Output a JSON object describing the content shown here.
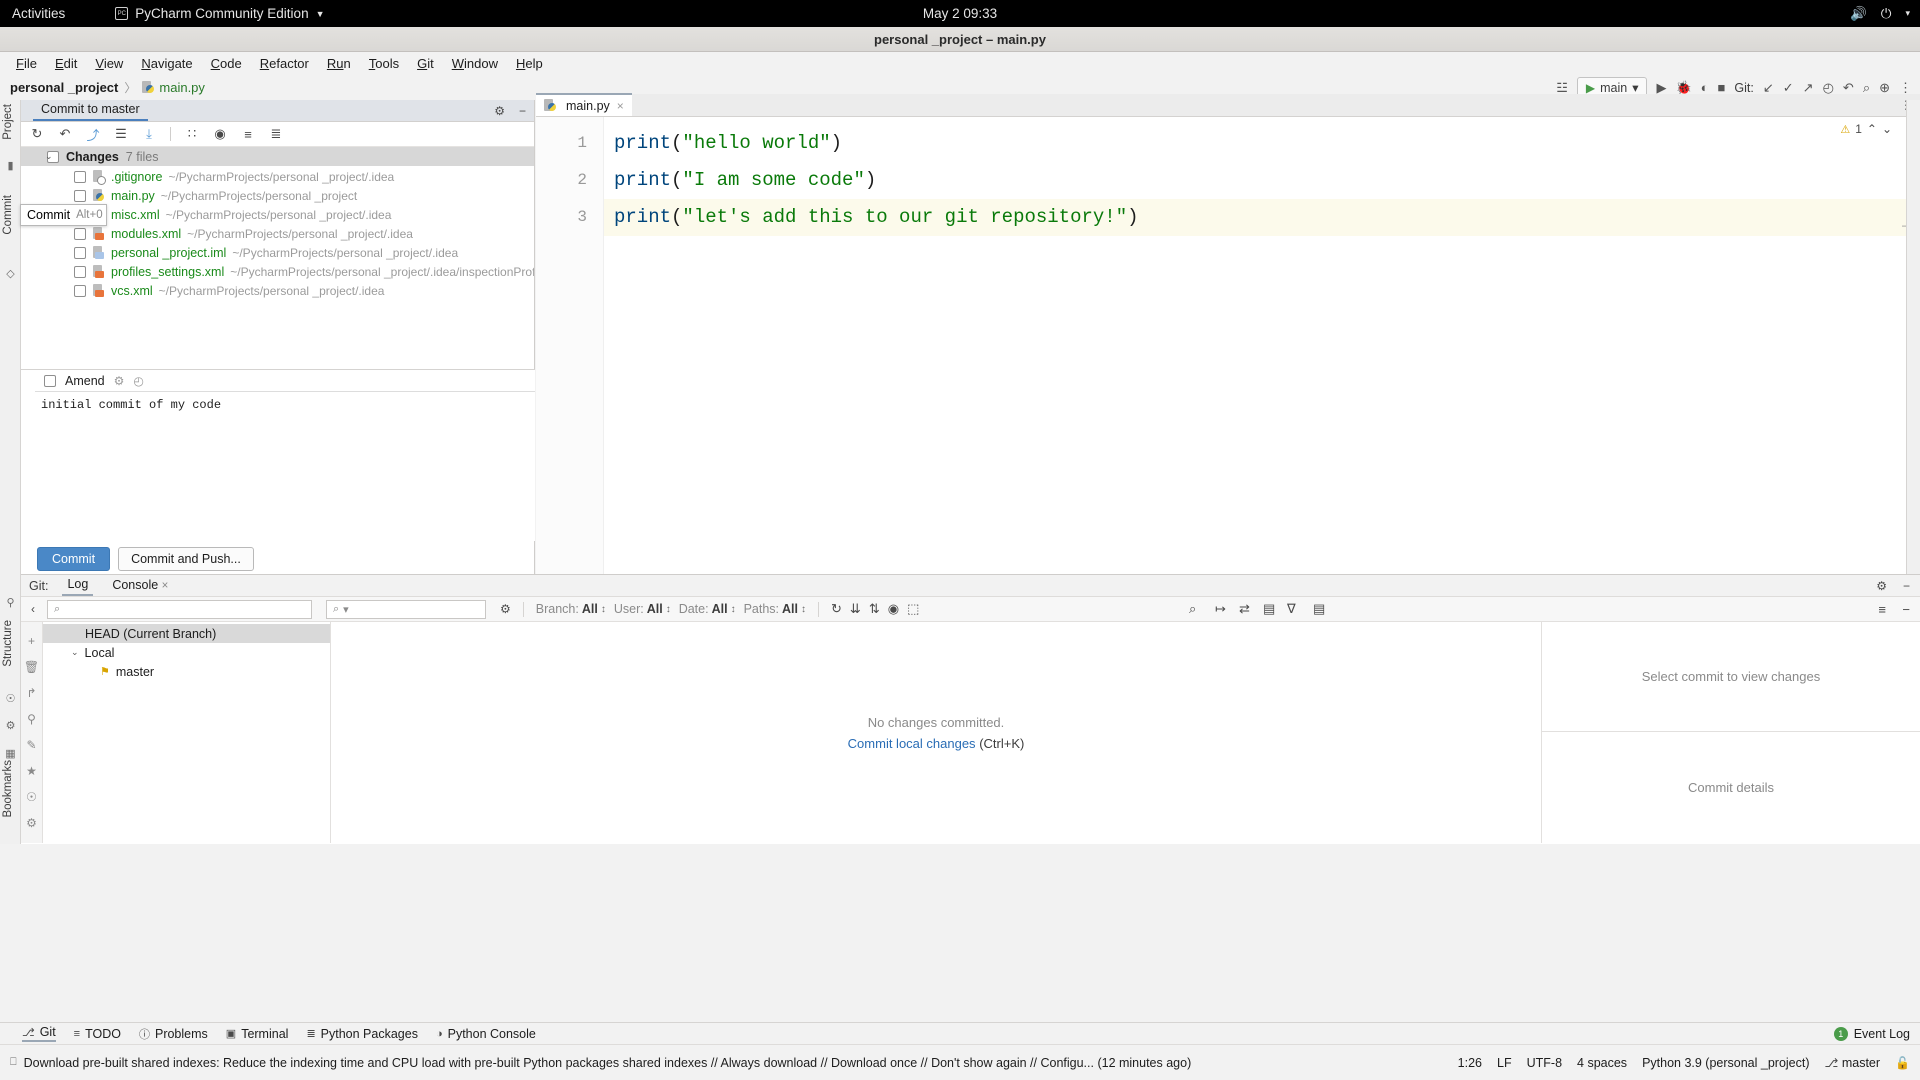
{
  "gnome": {
    "activities": "Activities",
    "app_name": "PyCharm Community Edition",
    "app_badge": "PC",
    "dropdown_caret": "▼",
    "clock": "May 2  09:33",
    "volume_icon": "🔊",
    "power_icon": "⏻",
    "caret_icon": "▾"
  },
  "window": {
    "title": "personal _project – main.py"
  },
  "menu": {
    "items": [
      {
        "mnemonic": "F",
        "rest": "ile"
      },
      {
        "mnemonic": "E",
        "rest": "dit"
      },
      {
        "mnemonic": "V",
        "rest": "iew"
      },
      {
        "mnemonic": "N",
        "rest": "avigate"
      },
      {
        "mnemonic": "C",
        "rest": "ode"
      },
      {
        "mnemonic": "R",
        "rest": "efactor"
      },
      {
        "mnemonic": "Ru",
        "rest": "n"
      },
      {
        "mnemonic": "T",
        "rest": "ools"
      },
      {
        "mnemonic": "G",
        "rest": "it"
      },
      {
        "mnemonic": "W",
        "rest": "indow"
      },
      {
        "mnemonic": "H",
        "rest": "elp"
      }
    ]
  },
  "navbar": {
    "project": "personal _project",
    "separator": "〉",
    "file": "main.py",
    "run_config": "main",
    "run_caret": "▾",
    "git_label": "Git:",
    "icons": {
      "run": "▶",
      "debug": "🐞",
      "coverage": "◐",
      "stop": "■",
      "update": "↙",
      "commit": "✓",
      "push": "↗",
      "history": "◴",
      "rollback": "↶",
      "search": "⌕",
      "plugin": "⊕",
      "more": "⋮",
      "layout": "☳"
    }
  },
  "left_strip": {
    "project_tab": "Project",
    "commit_tab": "Commit",
    "structure_tab": "Structure",
    "bookmarks_tab": "Bookmarks"
  },
  "commit_window": {
    "tab_label": "Commit to master",
    "header_icons": {
      "gear": "⚙",
      "minimize": "−"
    },
    "toolbar_icons": [
      {
        "name": "refresh-icon",
        "glyph": "↻"
      },
      {
        "name": "rollback-icon",
        "glyph": "↶"
      },
      {
        "name": "shelve-icon",
        "glyph": "⤴"
      },
      {
        "name": "diff-icon",
        "glyph": "☰"
      },
      {
        "name": "download-icon",
        "glyph": "⤓"
      },
      {
        "name": "group-by-icon",
        "glyph": "∷"
      },
      {
        "name": "preview-icon",
        "glyph": "◉"
      },
      {
        "name": "expand-all-icon",
        "glyph": "≡"
      },
      {
        "name": "collapse-all-icon",
        "glyph": "≣"
      }
    ],
    "changes_group": {
      "chevron": "⌄",
      "label": "Changes",
      "count": "7 files"
    },
    "files": [
      {
        "name": ".gitignore",
        "path": "~/PycharmProjects/personal _project/.idea",
        "icon": "gitignore-icon",
        "kind": "ign"
      },
      {
        "name": "main.py",
        "path": "~/PycharmProjects/personal _project",
        "icon": "python-file-icon",
        "kind": "py"
      },
      {
        "name": "misc.xml",
        "path": "~/PycharmProjects/personal _project/.idea",
        "icon": "xml-file-icon",
        "kind": "xml"
      },
      {
        "name": "modules.xml",
        "path": "~/PycharmProjects/personal _project/.idea",
        "icon": "xml-file-icon",
        "kind": "xml"
      },
      {
        "name": "personal _project.iml",
        "path": "~/PycharmProjects/personal _project/.idea",
        "icon": "iml-file-icon",
        "kind": "iml"
      },
      {
        "name": "profiles_settings.xml",
        "path": "~/PycharmProjects/personal _project/.idea/inspectionProfiles",
        "icon": "xml-file-icon",
        "kind": "xml"
      },
      {
        "name": "vcs.xml",
        "path": "~/PycharmProjects/personal _project/.idea",
        "icon": "xml-file-icon",
        "kind": "xml"
      }
    ],
    "tooltip": {
      "label": "Commit",
      "shortcut": "Alt+0"
    },
    "amend": {
      "label": "Amend",
      "gear_icon": "⚙",
      "history_icon": "◴"
    },
    "message": "initial commit of my code",
    "buttons": {
      "commit": "Commit",
      "commit_and_push": "Commit and Push..."
    }
  },
  "editor": {
    "tab": {
      "label": "main.py",
      "close": "×"
    },
    "gear_icon": "⋮",
    "warning": {
      "count": "1",
      "icon": "⚠",
      "chevron_up": "⌃",
      "chevron_down": "⌄"
    },
    "fold_mark": "—",
    "lines": [
      {
        "num": "1",
        "fn": "print",
        "open": "(",
        "string": "\"hello world\"",
        "close": ")"
      },
      {
        "num": "2",
        "fn": "print",
        "open": "(",
        "string": "\"I am some code\"",
        "close": ")"
      },
      {
        "num": "3",
        "fn": "print",
        "open": "(",
        "string": "\"let's add this to our git repository!\"",
        "close": ")"
      }
    ]
  },
  "git_window": {
    "label": "Git:",
    "tabs": [
      {
        "label": "Log",
        "active": true,
        "closable": false
      },
      {
        "label": "Console",
        "active": false,
        "closable": true,
        "close": "×"
      }
    ],
    "header_icons": {
      "gear": "⚙",
      "minimize": "−"
    },
    "toolbar": {
      "collapse_icon": "‹",
      "search_placeholder": "",
      "search_icon": "⌕",
      "branch_search_icon": "⌕",
      "branch_search_caret": "▾",
      "settings_icon": "⚙",
      "filters": [
        {
          "label": "Branch:",
          "value": "All"
        },
        {
          "label": "User:",
          "value": "All"
        },
        {
          "label": "Date:",
          "value": "All"
        },
        {
          "label": "Paths:",
          "value": "All"
        }
      ],
      "filter_caret": "↕",
      "right_icons": [
        {
          "name": "refresh-icon",
          "glyph": "↻"
        },
        {
          "name": "fetch-icon",
          "glyph": "⇊"
        },
        {
          "name": "sort-icon",
          "glyph": "⇅"
        },
        {
          "name": "eye-icon",
          "glyph": "◉"
        },
        {
          "name": "highlight-icon",
          "glyph": "⬚"
        },
        {
          "name": "go-to-hash-icon",
          "glyph": "↦"
        },
        {
          "name": "compare-icon",
          "glyph": "⇄"
        },
        {
          "name": "filter-icon",
          "glyph": "∇"
        },
        {
          "name": "columns-icon",
          "glyph": "▤"
        },
        {
          "name": "expand-icon",
          "glyph": "≡"
        },
        {
          "name": "minimize-icon",
          "glyph": "−"
        }
      ],
      "search_magnifier": "⌕"
    },
    "rail_icons": [
      {
        "name": "add-icon",
        "glyph": "+"
      },
      {
        "name": "delete-icon",
        "glyph": "🗑"
      },
      {
        "name": "checkout-icon",
        "glyph": "↱"
      },
      {
        "name": "favorite-icon",
        "glyph": "★"
      },
      {
        "name": "settings-icon",
        "glyph": "⚙"
      }
    ],
    "branches": [
      {
        "label": "HEAD (Current Branch)",
        "type": "head"
      },
      {
        "label": "Local",
        "type": "group"
      },
      {
        "label": "master",
        "type": "branch",
        "icon": "branch-tag-icon"
      }
    ],
    "commits_empty": {
      "message": "No changes committed.",
      "link": "Commit local changes",
      "shortcut": "(Ctrl+K)"
    },
    "details": {
      "top_text": "Select commit to view changes",
      "bottom_text": "Commit details"
    }
  },
  "bottom_tabs": {
    "items": [
      {
        "label": "Git",
        "icon": "⎇",
        "active": true
      },
      {
        "label": "TODO",
        "icon": "≡",
        "active": false
      },
      {
        "label": "Problems",
        "icon": "ⓘ",
        "active": false
      },
      {
        "label": "Terminal",
        "icon": "▣",
        "active": false
      },
      {
        "label": "Python Packages",
        "icon": "≣",
        "active": false
      },
      {
        "label": "Python Console",
        "icon": "◑",
        "active": false
      }
    ],
    "event_log": {
      "badge": "1",
      "label": "Event Log"
    }
  },
  "status_bar": {
    "message_icon": "⎕",
    "message": "Download pre-built shared indexes: Reduce the indexing time and CPU load with pre-built Python packages shared indexes // Always download // Download once // Don't show again // Configu... (12 minutes ago)",
    "caret_position": "1:26",
    "line_separator": "LF",
    "encoding": "UTF-8",
    "indent": "4 spaces",
    "interpreter": "Python 3.9 (personal _project)",
    "branch": "master",
    "branch_icon": "⎇",
    "lock_icon": "🔓"
  }
}
